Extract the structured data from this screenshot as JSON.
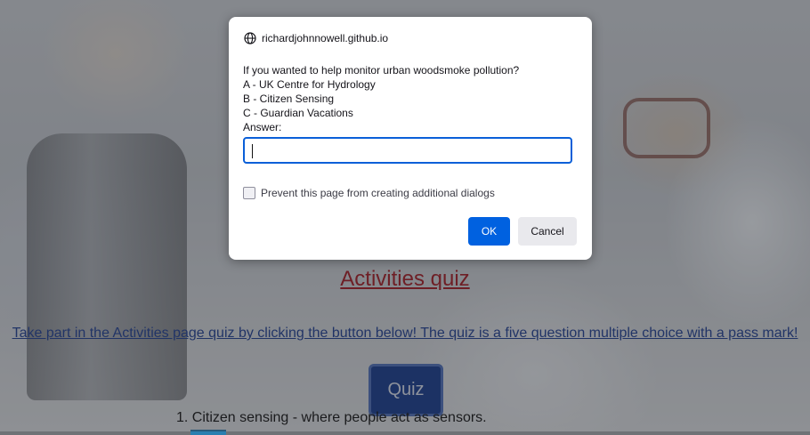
{
  "dialog": {
    "origin": "richardjohnnowell.github.io",
    "origin_icon": "globe-icon",
    "message_lines": [
      "If you wanted to help monitor urban woodsmoke pollution?",
      "A - UK Centre for Hydrology",
      "B - Citizen Sensing",
      "C - Guardian Vacations",
      "Answer:"
    ],
    "input_value": "",
    "checkbox_label": "Prevent this page from creating additional dialogs",
    "checkbox_checked": false,
    "ok_label": "OK",
    "cancel_label": "Cancel",
    "accent_color": "#0061e0"
  },
  "page": {
    "quiz_title": "Activities quiz",
    "quiz_description": "Take part in the Activities page quiz by clicking the button below! The quiz is a five question multiple choice with a pass mark!",
    "quiz_button_label": "Quiz",
    "answer_list": [
      "1. Citizen sensing - where people act as sensors."
    ],
    "title_color": "#a1181f",
    "link_color": "#1d3b8e",
    "button_color": "#14378a"
  }
}
